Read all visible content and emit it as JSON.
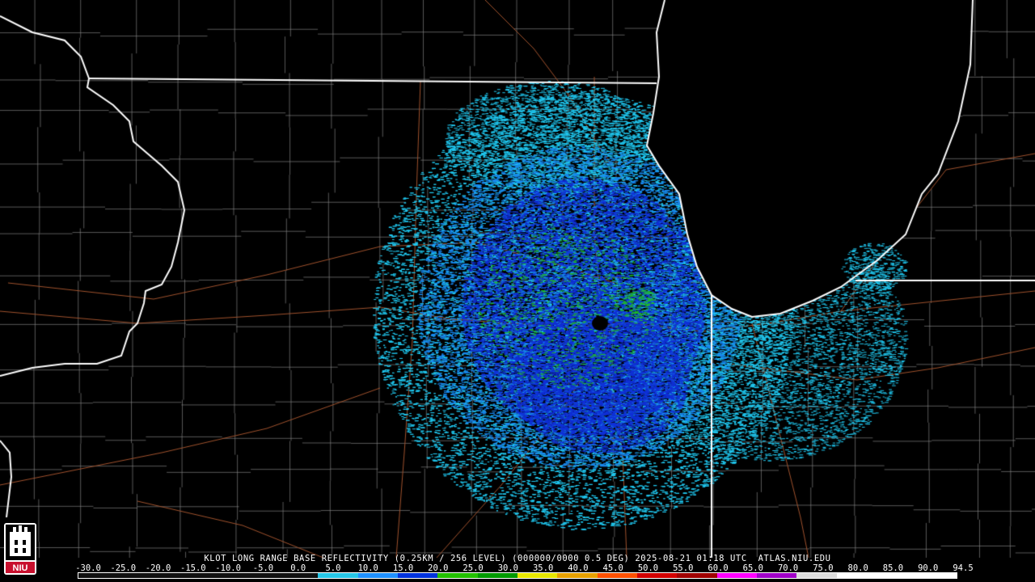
{
  "radar": {
    "title": "KLOT LONG RANGE BASE REFLECTIVITY (0.25KM / 256 LEVEL) (000000/0000 0.5 DEG) 2025-08-21 01:18 UTC  ATLAS.NIU.EDU",
    "logo_text": "NIU",
    "scale": {
      "labels": [
        "-30.0",
        "-25.0",
        "-20.0",
        "-15.0",
        "-10.0",
        "-5.0",
        "0.0",
        "5.0",
        "10.0",
        "15.0",
        "20.0",
        "25.0",
        "30.0",
        "35.0",
        "40.0",
        "45.0",
        "50.0",
        "55.0",
        "60.0",
        "65.0",
        "70.0",
        "75.0",
        "80.0",
        "85.0",
        "90.0",
        "94.5"
      ],
      "colors": [
        "#101010",
        "#101010",
        "#101010",
        "#101010",
        "#101010",
        "#101010",
        "#26c6e6",
        "#1e90ff",
        "#0032dc",
        "#22c000",
        "#009a00",
        "#e6e600",
        "#e6a000",
        "#ff5000",
        "#d20000",
        "#a00000",
        "#ff00ff",
        "#a000c8",
        "#dcdcdc",
        "#ffffff",
        "#ffffff",
        "#ffffff"
      ]
    },
    "map_colors": {
      "state_border": "#ffffff",
      "county_border": "#8a8a8a",
      "road": "#a0522d",
      "echo_light": "#20c8f0",
      "echo_mid": "#1888f0",
      "echo_dark": "#1030d8",
      "echo_green": "#20c020"
    }
  }
}
